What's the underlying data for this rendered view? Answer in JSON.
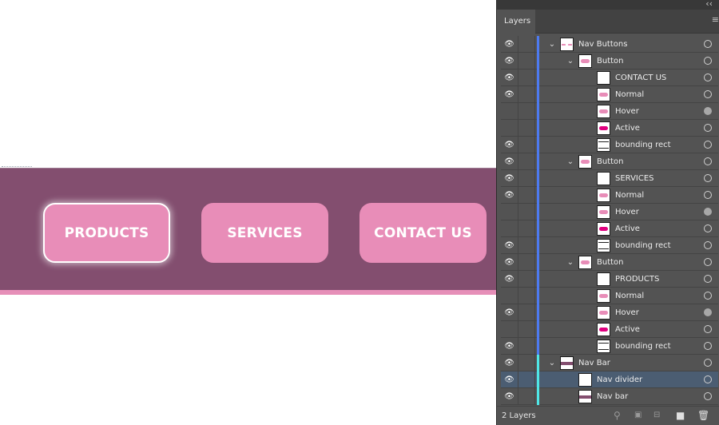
{
  "canvas": {
    "buttons": [
      {
        "label": "PRODUCTS",
        "state": "active"
      },
      {
        "label": "SERVICES",
        "state": "normal"
      },
      {
        "label": "CONTACT US",
        "state": "normal"
      }
    ],
    "colors": {
      "nav_bar": "#834e6f",
      "button_fill": "#e88db8",
      "divider": "#e68fb8",
      "active_swatch": "#e0007f"
    }
  },
  "panel": {
    "tab": "Layers",
    "layer_count": "2 Layers",
    "rows": [
      {
        "label": "Nav Buttons",
        "eye": true,
        "twirl": "open",
        "indent": 0,
        "thumb": "dashes",
        "target": "hollow",
        "bar": "blue"
      },
      {
        "label": "Button",
        "eye": true,
        "twirl": "open",
        "indent": 1,
        "thumb": "pill",
        "target": "hollow",
        "bar": "blue"
      },
      {
        "label": "CONTACT US",
        "eye": true,
        "twirl": "none",
        "indent": 2,
        "thumb": "blank",
        "target": "hollow",
        "bar": "blue"
      },
      {
        "label": "Normal",
        "eye": true,
        "twirl": "none",
        "indent": 2,
        "thumb": "pill",
        "target": "hollow",
        "bar": "blue"
      },
      {
        "label": "Hover",
        "eye": false,
        "twirl": "none",
        "indent": 2,
        "thumb": "pill",
        "target": "filled",
        "bar": "blue"
      },
      {
        "label": "Active",
        "eye": false,
        "twirl": "none",
        "indent": 2,
        "thumb": "pill-active",
        "target": "hollow",
        "bar": "blue"
      },
      {
        "label": "bounding rect",
        "eye": true,
        "twirl": "none",
        "indent": 2,
        "thumb": "rect",
        "target": "hollow",
        "bar": "blue"
      },
      {
        "label": "Button",
        "eye": true,
        "twirl": "open",
        "indent": 1,
        "thumb": "pill",
        "target": "hollow",
        "bar": "blue"
      },
      {
        "label": "SERVICES",
        "eye": true,
        "twirl": "none",
        "indent": 2,
        "thumb": "blank",
        "target": "hollow",
        "bar": "blue"
      },
      {
        "label": "Normal",
        "eye": true,
        "twirl": "none",
        "indent": 2,
        "thumb": "pill",
        "target": "hollow",
        "bar": "blue"
      },
      {
        "label": "Hover",
        "eye": false,
        "twirl": "none",
        "indent": 2,
        "thumb": "pill",
        "target": "filled",
        "bar": "blue"
      },
      {
        "label": "Active",
        "eye": false,
        "twirl": "none",
        "indent": 2,
        "thumb": "pill-active",
        "target": "hollow",
        "bar": "blue"
      },
      {
        "label": "bounding rect",
        "eye": true,
        "twirl": "none",
        "indent": 2,
        "thumb": "rect",
        "target": "hollow",
        "bar": "blue"
      },
      {
        "label": "Button",
        "eye": true,
        "twirl": "open",
        "indent": 1,
        "thumb": "pill",
        "target": "hollow",
        "bar": "blue"
      },
      {
        "label": "PRODUCTS",
        "eye": true,
        "twirl": "none",
        "indent": 2,
        "thumb": "blank",
        "target": "hollow",
        "bar": "blue"
      },
      {
        "label": "Normal",
        "eye": false,
        "twirl": "none",
        "indent": 2,
        "thumb": "pill",
        "target": "hollow",
        "bar": "blue"
      },
      {
        "label": "Hover",
        "eye": true,
        "twirl": "none",
        "indent": 2,
        "thumb": "pill",
        "target": "filled",
        "bar": "blue"
      },
      {
        "label": "Active",
        "eye": false,
        "twirl": "none",
        "indent": 2,
        "thumb": "pill-active",
        "target": "hollow",
        "bar": "blue"
      },
      {
        "label": "bounding rect",
        "eye": true,
        "twirl": "none",
        "indent": 2,
        "thumb": "rect",
        "target": "hollow",
        "bar": "blue"
      },
      {
        "label": "Nav Bar",
        "eye": true,
        "twirl": "open",
        "indent": 0,
        "thumb": "bar",
        "target": "hollow",
        "bar": "cyan"
      },
      {
        "label": "Nav divider",
        "eye": true,
        "twirl": "none",
        "indent": 1,
        "thumb": "blank",
        "target": "hollow",
        "bar": "cyan",
        "selected": true
      },
      {
        "label": "Nav bar",
        "eye": true,
        "twirl": "none",
        "indent": 1,
        "thumb": "bar",
        "target": "hollow",
        "bar": "cyan"
      }
    ]
  },
  "icons": {
    "eye": "eye-icon",
    "twirl_open": "chevron-down-icon",
    "collapse": "double-chevron-left-icon",
    "panel_menu": "hamburger-menu-icon",
    "footer": [
      "search-icon",
      "make-clipping-mask-icon",
      "create-sublayer-icon",
      "new-layer-icon",
      "trash-icon"
    ]
  }
}
